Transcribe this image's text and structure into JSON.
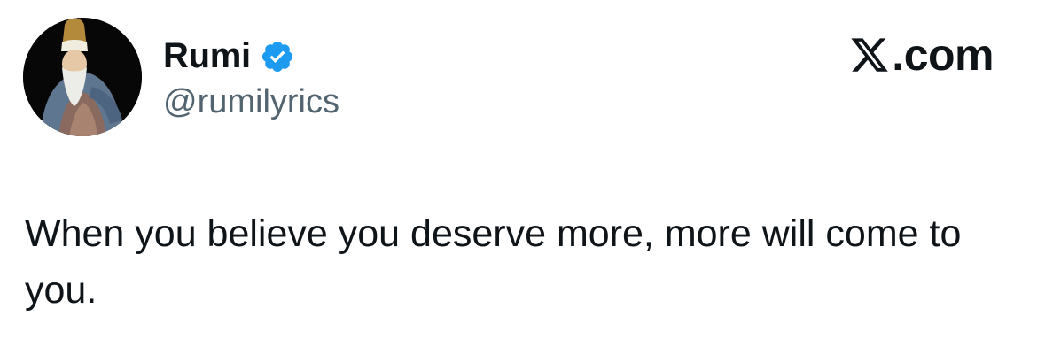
{
  "tweet": {
    "author": {
      "display_name": "Rumi",
      "handle": "@rumilyrics",
      "verified": true,
      "avatar_icon": "portrait-avatar"
    },
    "brand": {
      "icon": "x-logo-icon",
      "text": ".com"
    },
    "text": "When you believe you deserve more, more will come to you."
  },
  "colors": {
    "text_primary": "#0f1419",
    "text_secondary": "#536471",
    "verified_blue": "#1d9bf0",
    "background": "#ffffff"
  }
}
